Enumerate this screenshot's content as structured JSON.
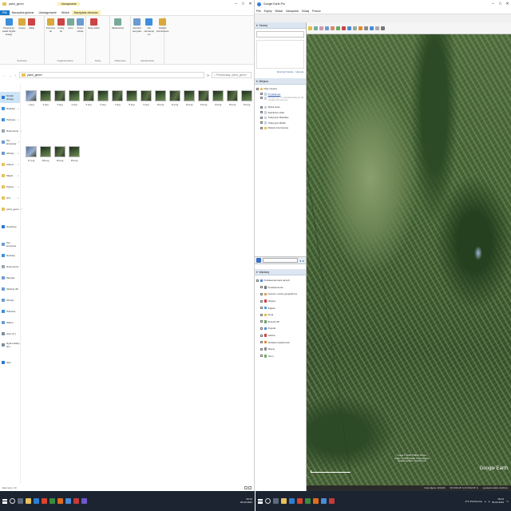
{
  "explorer": {
    "title": "ywiol_geom",
    "context_tab": "Zarządzanie",
    "tabs": [
      "Plik",
      "Narzędzia główne",
      "Udostępnianie",
      "Widok",
      "Narzędzia obrazów"
    ],
    "ribbon": {
      "groups": [
        {
          "label": "Schowek",
          "buttons": [
            "Przypnij do paska Szybki dostęp",
            "Kopiuj",
            "Wklej"
          ]
        },
        {
          "label": "Organizowanie",
          "buttons": [
            "Przenieś do",
            "Kopiuj do",
            "Usuń",
            "Zmień nazwę"
          ]
        },
        {
          "label": "Nowy",
          "buttons": [
            "Nowy folder"
          ]
        },
        {
          "label": "Otwieranie",
          "buttons": [
            "Właściwości"
          ]
        },
        {
          "label": "Zaznaczanie",
          "buttons": [
            "Zaznacz wszystko",
            "Nie zaznaczaj nic",
            "Odwróć zaznaczenie"
          ]
        }
      ]
    },
    "address": "ywiol_geom",
    "search_placeholder": "Przeszukaj: ywiol_geom",
    "nav": [
      {
        "label": "Szybki dostęp",
        "color": "#2b79d3",
        "selected": true
      },
      {
        "label": "Desktop",
        "color": "#3c8fdc"
      },
      {
        "label": "Pobrane",
        "color": "#3c8fdc"
      },
      {
        "label": "Dokumenty",
        "color": "#9aa4b1"
      },
      {
        "label": "Ten komputer",
        "color": "#6b9bd1"
      },
      {
        "label": "Obrazy",
        "color": "#6b9bd1"
      },
      {
        "label": "Arkusz",
        "color": "#e8c15a"
      },
      {
        "label": "Mapki",
        "color": "#e8c15a"
      },
      {
        "label": "Python",
        "color": "#e8c15a"
      },
      {
        "label": "STL",
        "color": "#e8c15a"
      },
      {
        "label": "ywiol_geom",
        "color": "#e8c15a"
      },
      {
        "label": "OneDrive",
        "color": "#2b79d3"
      },
      {
        "label": "Ten komputer",
        "color": "#6b9bd1"
      },
      {
        "label": "Desktop",
        "color": "#3c8fdc"
      },
      {
        "label": "Dokumenty",
        "color": "#9aa4b1"
      },
      {
        "label": "Muzyka",
        "color": "#6b9bd1"
      },
      {
        "label": "Obiekty 3D",
        "color": "#6b9bd1"
      },
      {
        "label": "Obrazy",
        "color": "#6b9bd1"
      },
      {
        "label": "Pobrane",
        "color": "#3c8fdc"
      },
      {
        "label": "Wideo",
        "color": "#6b9bd1"
      },
      {
        "label": "Acer (C:)",
        "color": "#7f8b99"
      },
      {
        "label": "Dysk lokalny (D:)",
        "color": "#7f8b99"
      },
      {
        "label": "Sieć",
        "color": "#2b79d3"
      }
    ],
    "files": [
      {
        "name": "1.png",
        "kind": "a"
      },
      {
        "name": "2.png",
        "kind": "b"
      },
      {
        "name": "3.png",
        "kind": "c"
      },
      {
        "name": "4.png",
        "kind": "b"
      },
      {
        "name": "5.png",
        "kind": "c"
      },
      {
        "name": "6.png",
        "kind": "b"
      },
      {
        "name": "7.png",
        "kind": "c"
      },
      {
        "name": "8.png",
        "kind": "b"
      },
      {
        "name": "9.png",
        "kind": "c"
      },
      {
        "name": "10.png",
        "kind": "b"
      },
      {
        "name": "11.png",
        "kind": "c"
      },
      {
        "name": "12.png",
        "kind": "b"
      },
      {
        "name": "13.png",
        "kind": "c"
      },
      {
        "name": "14.png",
        "kind": "b"
      },
      {
        "name": "15.png",
        "kind": "c"
      },
      {
        "name": "16.png",
        "kind": "b"
      },
      {
        "name": "17.png",
        "kind": "a"
      },
      {
        "name": "18.png",
        "kind": "b"
      },
      {
        "name": "19.png",
        "kind": "c"
      },
      {
        "name": "20.png",
        "kind": "b"
      }
    ],
    "status": "Elementy: 20"
  },
  "earth": {
    "title": "Google Earth Pro",
    "menu": [
      "Plik",
      "Edytuj",
      "Widok",
      "Narzędzia",
      "Dodaj",
      "Pomoc"
    ],
    "search_panel": "Szukaj",
    "history_links": [
      "Wyczyść historię",
      "Historia"
    ],
    "places_panel": "Miejsca",
    "places_items": [
      {
        "label": "Moje miejsca",
        "check": true
      },
      {
        "label": "Przykładowa",
        "check": true,
        "link": true
      },
      {
        "label": "Upewnij się, że warstwa Budynki 3D została zaznaczona",
        "check": false
      },
      {
        "label": "Widok stoku",
        "check": true
      },
      {
        "label": "Zabytkowy szlak",
        "check": true
      },
      {
        "label": "Tradycyjne Malediwy",
        "check": true
      },
      {
        "label": "Tradycyjne Maldiv",
        "check": true
      },
      {
        "label": "Miejsca tymczasowe",
        "check": true
      }
    ],
    "layers_panel": "Warstwy",
    "layers_items": [
      {
        "label": "Podstawowa baza danych",
        "color": "#4c8bd6"
      },
      {
        "label": "Powiadomienia",
        "color": "#777"
      },
      {
        "label": "Granice i nazwy geograficzne",
        "color": "#d6a44c"
      },
      {
        "label": "Miejsca",
        "color": "#c44"
      },
      {
        "label": "Zdjęcia",
        "color": "#4c9ad6"
      },
      {
        "label": "Drogi",
        "color": "#e0c040"
      },
      {
        "label": "Budynki 3D",
        "color": "#6a6"
      },
      {
        "label": "Pogoda",
        "color": "#4c8bd6"
      },
      {
        "label": "Galeria",
        "color": "#c44"
      },
      {
        "label": "Globalna świadomość",
        "color": "#e08a2c"
      },
      {
        "label": "Więcej",
        "color": "#888"
      },
      {
        "label": "Teren",
        "color": "#7a6"
      }
    ],
    "copyright": [
      "Image © 2020 CNES / Airbus",
      "Image © 2020 Maxar Technologies",
      "Image Landsat / Copernicus"
    ],
    "logo": "Google Earth",
    "status": [
      "Data zdjęcia: 3/2/2020",
      "52°21'08.18\" N 21°46'22.66\" E",
      "wysokość widoku 10,39 km"
    ]
  },
  "taskbar_left": {
    "time": "09:12",
    "date": "04.02.2021"
  },
  "taskbar_right": {
    "weather": "-2°C Pochmurno",
    "time": "09:12",
    "date": "04.02.2021"
  }
}
